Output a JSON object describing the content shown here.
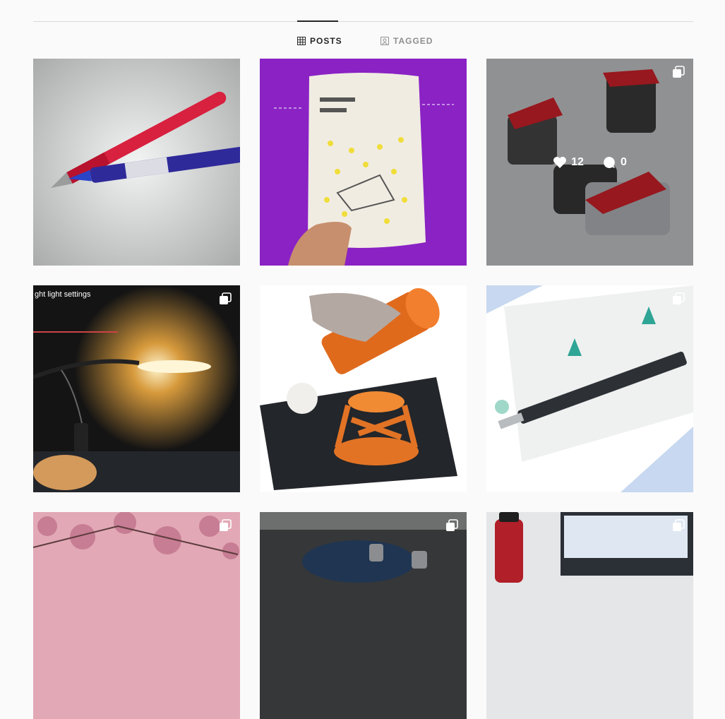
{
  "tabs": {
    "posts_label": "POSTS",
    "tagged_label": "TAGGED",
    "active": "posts"
  },
  "grid": {
    "posts": [
      {
        "id": "pens",
        "multi": false
      },
      {
        "id": "snack-pouch",
        "multi": false
      },
      {
        "id": "sharpeners",
        "multi": true,
        "hover": true,
        "likes": "12",
        "comments": "0"
      },
      {
        "id": "desk-lamp",
        "multi": true,
        "caption": "ght light settings"
      },
      {
        "id": "orange-cup",
        "multi": false
      },
      {
        "id": "mechanical-pencil",
        "multi": true
      },
      {
        "id": "cherry-blossom",
        "multi": true
      },
      {
        "id": "dark-desk",
        "multi": true
      },
      {
        "id": "water-bottle",
        "multi": true
      }
    ]
  },
  "icons": {
    "posts_tab": "grid-icon",
    "tagged_tab": "tag-icon",
    "multi": "carousel-icon",
    "like": "heart-icon",
    "comment": "comment-icon"
  }
}
